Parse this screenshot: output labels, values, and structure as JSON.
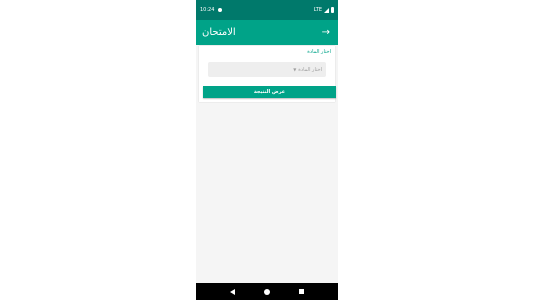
{
  "status_bar": {
    "time": "10:24",
    "network": "LTE"
  },
  "app_bar": {
    "title": "الامتحان",
    "back_icon": "arrow-right-icon"
  },
  "form": {
    "subject_label": "اختار المادة",
    "subject_select_value": "اختار المادة",
    "show_result_button": "عرض النتيجة"
  },
  "colors": {
    "status_bar": "#00796b",
    "primary": "#00a388",
    "background": "#f5f5f5"
  }
}
